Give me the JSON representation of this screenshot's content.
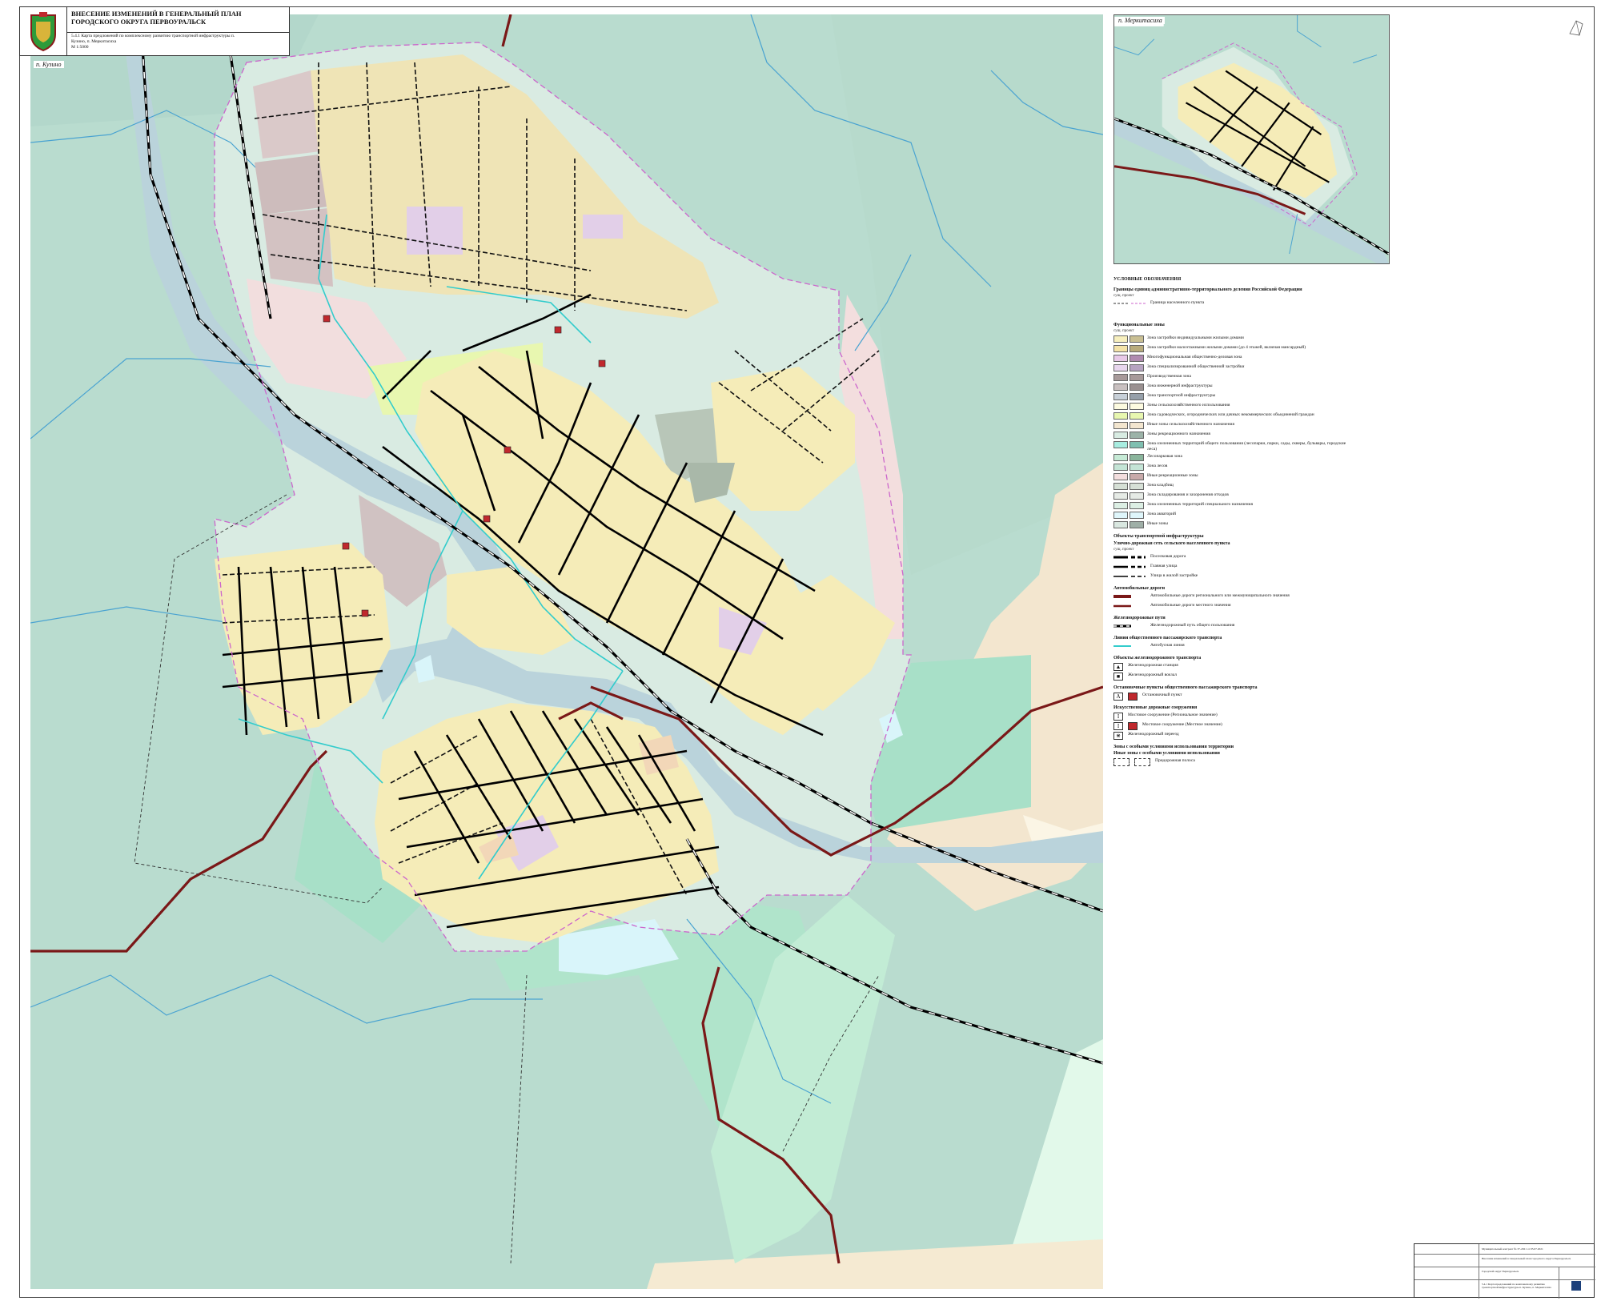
{
  "title_block": {
    "title": "ВНЕСЕНИЕ ИЗМЕНЕНИЙ В ГЕНЕРАЛЬНЫЙ ПЛАН ГОРОДСКОГО ОКРУГА ПЕРВОУРАЛЬСК",
    "subtitle": "5.4.1 Карта предложений по комплексному развитию транспортной инфраструктуры п. Кузино, п. Меркитасиха",
    "scale": "М 1:5000"
  },
  "map": {
    "main_place": "п. Кузино",
    "inset_place": "п. Меркитасиха",
    "colors": {
      "forest": "#b9dccf",
      "residential": "#f5ecb8",
      "residential_dark": "#ece1ad",
      "water": "#bad3db",
      "river": "#4aa3d1",
      "regional_road": "#7a1818",
      "bus_line": "#33cccc",
      "boundary": "#cc66cc",
      "public_business": "#e2cfe8",
      "industrial": "#d4c2c2",
      "agri": "#e8f7b0",
      "green_special": "#a8e0c8",
      "other_agri": "#f3e6cf"
    }
  },
  "legend": {
    "title": "УСЛОВНЫЕ ОБОЗНАЧЕНИЯ",
    "admin_header": "Границы единиц административно-территориального деления Российской Федерации",
    "exist_proj": "сущ.    проект",
    "settlement_boundary": "Граница населенного пункта",
    "func_header": "Функциональные зоны",
    "zones": [
      {
        "label": "Зона застройки индивидуальными жилыми домами",
        "c1": "#f7efbe",
        "c2": "#c9bf93"
      },
      {
        "label": "Зона застройки малоэтажными жилыми домами (до 4 этажей, включая мансардный)",
        "c1": "#f4e3a8",
        "c2": "#b8ab7c"
      },
      {
        "label": "Многофункциональная общественно-деловая зона",
        "c1": "#e8c9e8",
        "c2": "#b08bb0"
      },
      {
        "label": "Зона специализированной общественной застройки",
        "c1": "#e8d6ee",
        "c2": "#b7a3c1"
      },
      {
        "label": "Производственная зона",
        "c1": "#a89a9a",
        "c2": "#a89a9a"
      },
      {
        "label": "Зона инженерной инфраструктуры",
        "c1": "#c9c0c0",
        "c2": "#9a9090"
      },
      {
        "label": "Зона транспортной инфраструктуры",
        "c1": "#c8d0d8",
        "c2": "#96a0aa"
      },
      {
        "label": "Зоны сельскохозяйственного использования",
        "c1": "#fdfbe0",
        "c2": "#fdfbe0"
      },
      {
        "label": "Зона садоводческих, огороднических или дачных некоммерческих объединений граждан",
        "c1": "#e8f7b0",
        "c2": "#e8f7b0"
      },
      {
        "label": "Иные зоны сельскохозяйственного назначения",
        "c1": "#f3e6cf",
        "c2": "#f3e6cf"
      },
      {
        "label": "Зоны рекреационного назначения",
        "c1": "#d8ebe2",
        "c2": "#9cb3a8"
      },
      {
        "label": "Зона озелененных территорий общего пользования (лесопарки, парки, сады, скверы, бульвары, городские леса)",
        "c1": "#a8ece0",
        "c2": "#7fbfb0"
      },
      {
        "label": "Лесопарковая зона",
        "c1": "#c6ead6",
        "c2": "#8ab59c"
      },
      {
        "label": "Зона лесов",
        "c1": "#c4e4d6",
        "c2": "#c4e4d6"
      },
      {
        "label": "Иные рекреационные зоны",
        "c1": "#f3dede",
        "c2": "#c8aaaa"
      },
      {
        "label": "Зона кладбищ",
        "c1": "#d6e0d6",
        "c2": "#d6e0d6"
      },
      {
        "label": "Зона складирования и захоронения отходов",
        "c1": "#e6ebe6",
        "c2": "#e6ebe6"
      },
      {
        "label": "Зона озелененных территорий специального назначения",
        "c1": "#dcefe4",
        "c2": "#dcefe4"
      },
      {
        "label": "Зона акваторий",
        "c1": "#dff6fb",
        "c2": "#dff6fb"
      },
      {
        "label": "Иные зоны",
        "c1": "#d9e7e0",
        "c2": "#9fafa7"
      }
    ],
    "transport_header": "Объекты транспортной инфраструктуры",
    "street_header": "Улично-дорожная сеть сельского населенного пункта",
    "streets": [
      "Поселковая дорога",
      "Главная улица",
      "Улица в жилой застройке"
    ],
    "auto_header": "Автомобильные дороги",
    "auto": [
      "Автомобильные дороги регионального или межмуниципального значения",
      "Автомобильные дороги местного значения"
    ],
    "rail_header": "Железнодорожные пути",
    "rail": "Железнодорожный путь общего пользования",
    "public_header": "Линии общественного пассажирского транспорта",
    "bus": "Автобусная линия",
    "rail_objects_header": "Объекты железнодорожного транспорта",
    "rail_objects": [
      "Железнодорожная станция",
      "Железнодорожный вокзал"
    ],
    "stops_header": "Остановочные пункты общественного пассажирского транспорта",
    "stop": "Остановочный пункт",
    "bridges_header": "Искусственные дорожные сооружения",
    "bridges": [
      "Мостовое сооружение (Региональное значение)",
      "Мостовое сооружение (Местное значение)",
      "Железнодорожный переезд"
    ],
    "special_header": "Зоны с особыми условиями использования территории",
    "special_sub": "Иные зоны с особыми условиями использования",
    "special": "Придорожная полоса"
  },
  "stamp": {
    "contract": "Муниципальный контракт № 37-2021 от 05.07.2021",
    "project": "Внесение изменений в генеральный план городского округа Первоуральск",
    "org": "Городской округ Первоуральск",
    "sheet": "5.4.1 Карта предложений по комплексному развитию транспортной инфраструктуры п. Кузино, п. Меркитасиха"
  }
}
